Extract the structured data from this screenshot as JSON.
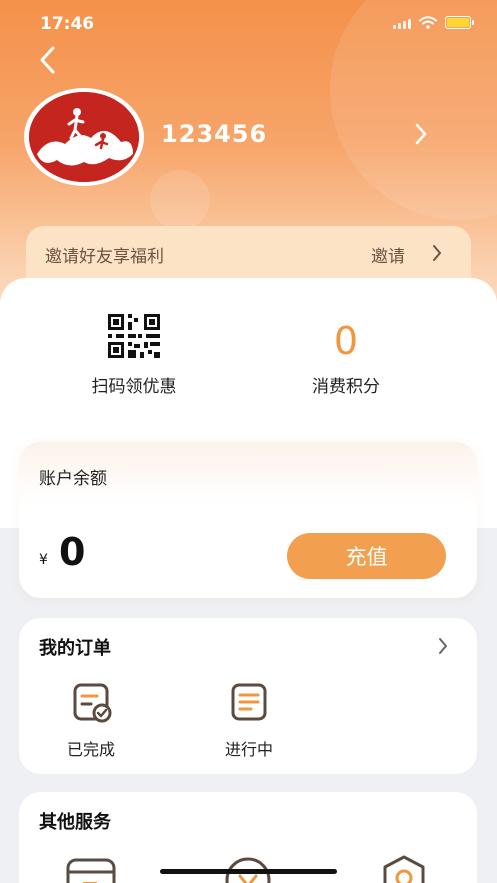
{
  "status_bar": {
    "time": "17:46"
  },
  "profile": {
    "username": "123456"
  },
  "invite": {
    "text": "邀请好友享福利",
    "action": "邀请"
  },
  "quick": {
    "scan_label": "扫码领优惠",
    "points_label": "消费积分",
    "points_value": "0"
  },
  "balance": {
    "title": "账户余额",
    "currency": "¥",
    "value": "0",
    "recharge_label": "充值"
  },
  "orders": {
    "title": "我的订单",
    "items": [
      {
        "label": "已完成"
      },
      {
        "label": "进行中"
      }
    ]
  },
  "services": {
    "title": "其他服务"
  },
  "colors": {
    "brand_orange": "#f4914a",
    "accent": "#f2a04f",
    "points": "#f0963c",
    "icon_stroke": "#5a4a40"
  }
}
